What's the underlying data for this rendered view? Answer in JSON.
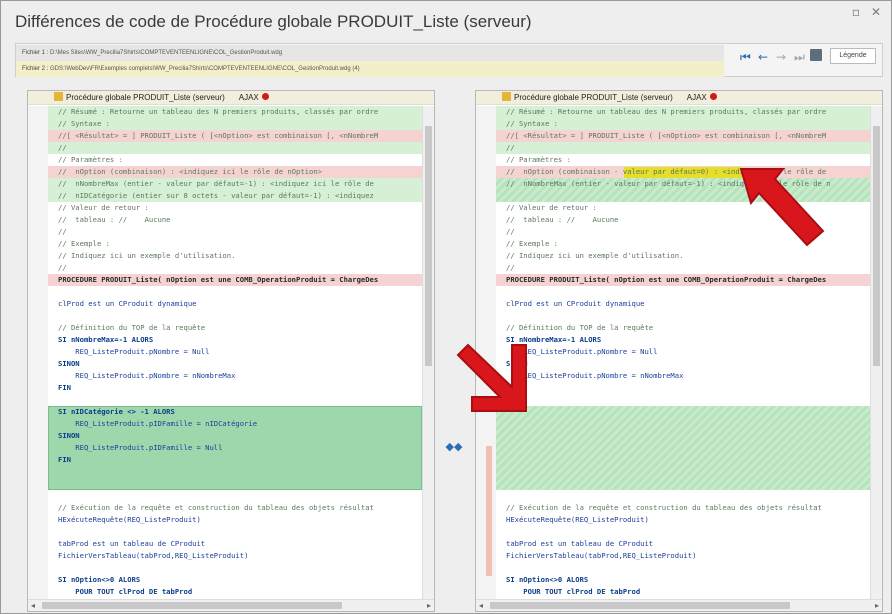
{
  "window": {
    "title": "Différences de code de Procédure globale PRODUIT_Liste (serveur)",
    "min": "▫",
    "close": "✕"
  },
  "files": {
    "f1_label": "Fichier 1 :",
    "f1_path": "D:\\Mes Sites\\WW_Precilia7Shirts\\COMPTEVENTEENLIGNE\\COL_GestionProduit.wdg",
    "f2_label": "Fichier 2 :",
    "f2_path": "GDS:\\WebDev\\FR\\Exemples complets\\WW_Precilia7Shirts\\COMPTEVENTEENLIGNE\\COL_GestionProduit.wdg (4)",
    "legend": "Légende"
  },
  "nav": {
    "first": "⏮",
    "prev": "←",
    "next": "→",
    "last": "⏭"
  },
  "left": {
    "header": "Procédure globale PRODUIT_Liste (serveur)",
    "ajax": "AJAX"
  },
  "right": {
    "header": "Procédure globale PRODUIT_Liste (serveur)",
    "ajax": "AJAX"
  },
  "code_left": [
    "// Résumé : Retourne un tableau des N premiers produits, classés par ordre",
    "// Syntaxe :",
    "//[ <Résultat> = ] PRODUIT_Liste ( [<nOption> est combinaison [, <nNombreM",
    "//",
    "// Paramètres :",
    "//  nOption (combinaison) : <indiquez ici le rôle de nOption>",
    "//  nNombreMax (entier - valeur par défaut=-1) : <indiquez ici le rôle de",
    "//  nIDCatégorie (entier sur 8 octets - valeur par défaut=-1) : <indiquez",
    "// Valeur de retour :",
    "//  tableau : //    Aucune",
    "//",
    "// Exemple :",
    "// Indiquez ici un exemple d'utilisation.",
    "//",
    "PROCEDURE PRODUIT_Liste( nOption est une COMB_OperationProduit = ChargeDes",
    "",
    "clProd est un CProduit dynamique",
    "",
    "// Définition du TOP de la requête",
    "SI nNombreMax=-1 ALORS",
    "    REQ_ListeProduit.pNombre = Null",
    "SINON",
    "    REQ_ListeProduit.pNombre = nNombreMax",
    "FIN",
    "",
    "SI nIDCatégorie <> -1 ALORS",
    "    REQ_ListeProduit.pIDFamille = nIDCatégorie",
    "SINON",
    "    REQ_ListeProduit.pIDFamille = Null",
    "FIN",
    "",
    "",
    "",
    "// Exécution de la requête et construction du tableau des objets résultat",
    "HExécuteRequête(REQ_ListeProduit)",
    "",
    "tabProd est un tableau de CProduit",
    "FichierVersTableau(tabProd,REQ_ListeProduit)",
    "",
    "SI nOption<>0 ALORS",
    "    POUR TOUT clProd DE tabProd",
    "        clProd.ChargeInfo(nOption)"
  ],
  "code_right": [
    "// Résumé : Retourne un tableau des N premiers produits, classés par ordre",
    "// Syntaxe :",
    "//[ <Résultat> = ] PRODUIT_Liste ( [<nOption> est combinaison [, <nNombreM",
    "//",
    "// Paramètres :",
    "//  nOption (combinaison - valeur par défaut=0) : <indiquez ici le rôle de",
    "//  nNombreMax (entier - valeur par défaut=-1) : <indiquez ici le rôle de n",
    "",
    "// Valeur de retour :",
    "//  tableau : //    Aucune",
    "//",
    "// Exemple :",
    "// Indiquez ici un exemple d'utilisation.",
    "//",
    "PROCEDURE PRODUIT_Liste( nOption est une COMB_OperationProduit = ChargeDes",
    "",
    "clProd est un CProduit dynamique",
    "",
    "// Définition du TOP de la requête",
    "SI nNombreMax=-1 ALORS",
    "    REQ_ListeProduit.pNombre = Null",
    "SINON",
    "    REQ_ListeProduit.pNombre = nNombreMax",
    "FIN",
    "",
    "",
    "",
    "",
    "",
    "",
    "",
    "",
    "",
    "// Exécution de la requête et construction du tableau des objets résultat",
    "HExécuteRequête(REQ_ListeProduit)",
    "",
    "tabProd est un tableau de CProduit",
    "FichierVersTableau(tabProd,REQ_ListeProduit)",
    "",
    "SI nOption<>0 ALORS",
    "    POUR TOUT clProd DE tabProd",
    "        clProd.ChargeInfo(nOption)"
  ],
  "colors": {
    "removed": "#f6d3d3",
    "added": "#d6f0d6",
    "block": "#9ed7ab",
    "changed": "#e6de29",
    "arrow": "#d9161c"
  }
}
